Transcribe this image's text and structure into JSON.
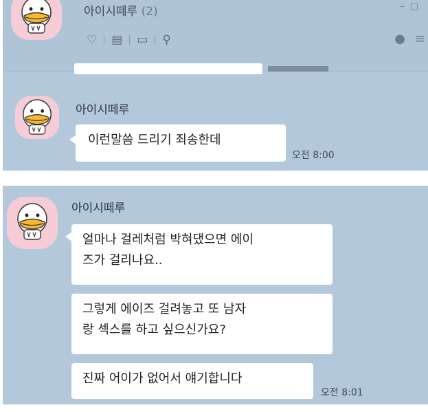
{
  "top_panel": {
    "header": {
      "chat_title": "아이시떼루",
      "member_count": "(2)",
      "icons": [
        "heart-icon",
        "notes-icon",
        "album-icon",
        "search-icon"
      ],
      "right_icons": [
        "bell-icon",
        "menu-icon"
      ]
    },
    "sender_name": "아이시떼루",
    "message": "이런말씀 드리기 죄송한데",
    "time": "오전 8:00"
  },
  "bottom_panel": {
    "sender_name": "아이시떼루",
    "messages": [
      {
        "line1": "얼마나 걸레처럼 박혀댔으면 에이",
        "line2": "즈가 걸리나요.."
      },
      {
        "line1": "그렇게 에이즈 걸려놓고 또 남자",
        "line2": "랑 섹스를 하고 싶으신가요?"
      },
      {
        "line1": "진짜 어이가 없어서 얘기합니다"
      }
    ],
    "time": "오전 8:01"
  },
  "colors": {
    "chat_background": "#b4c8dc",
    "bubble": "#ffffff",
    "avatar_background": "#f6cdd7"
  }
}
